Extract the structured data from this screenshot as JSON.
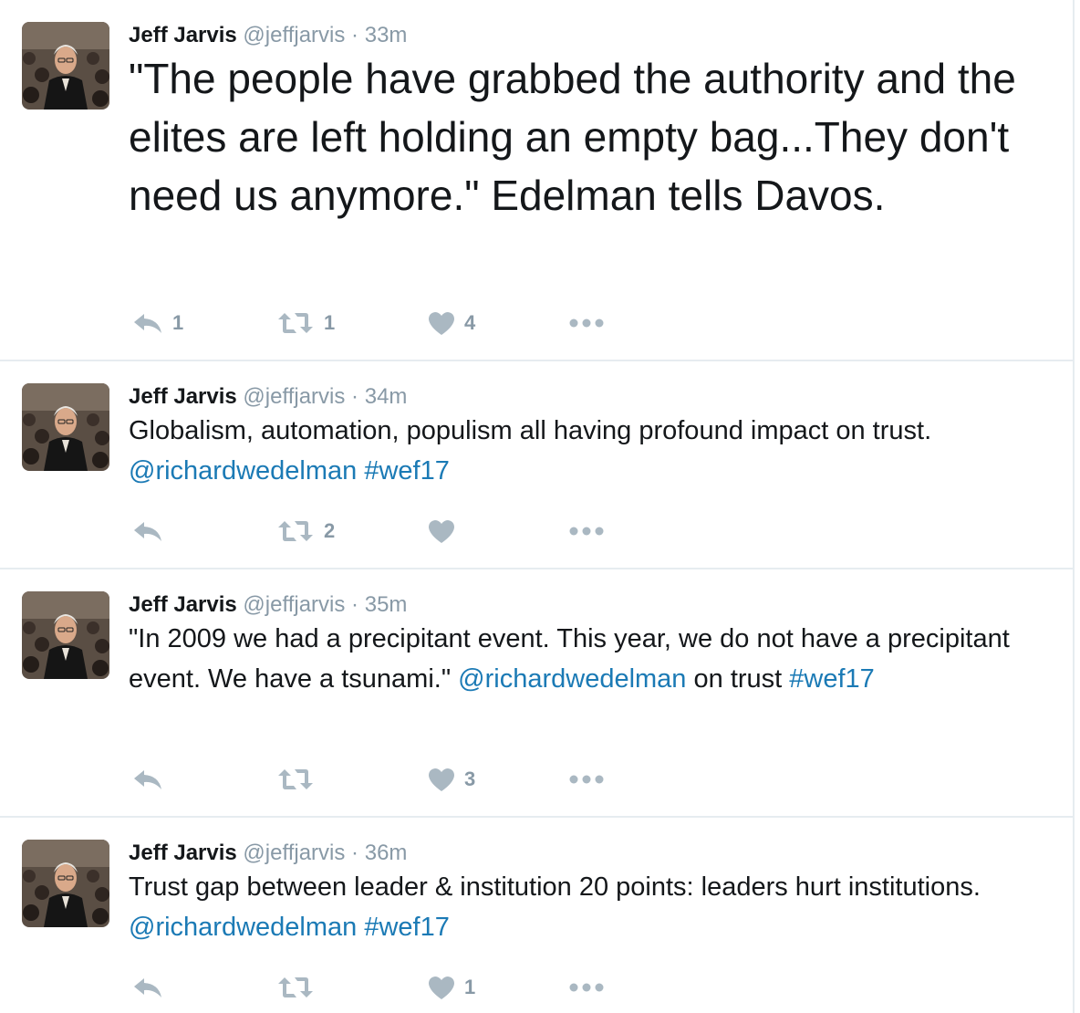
{
  "colors": {
    "link": "#1b7ab5",
    "meta": "#8899a6",
    "text": "#14171a",
    "divider": "#e6ecf0"
  },
  "icons": [
    "reply-icon",
    "retweet-icon",
    "like-heart-icon",
    "more-dots-icon"
  ],
  "tweets": [
    {
      "fullname": "Jeff Jarvis",
      "handle": "@jeffjarvis",
      "sep": "·",
      "time": "33m",
      "text_before": "\"The people have grabbed the authority and the elites are left holding an empty bag...They don't need us anymore.\" Edelman tells Davos.",
      "reply_count": "1",
      "retweet_count": "1",
      "like_count": "4"
    },
    {
      "fullname": "Jeff Jarvis",
      "handle": "@jeffjarvis",
      "sep": "·",
      "time": "34m",
      "text_before": "Globalism, automation, populism all having profound impact on trust. ",
      "mention": "@richardwedelman",
      "hashtag": "#wef17",
      "reply_count": "",
      "retweet_count": "2",
      "like_count": ""
    },
    {
      "fullname": "Jeff Jarvis",
      "handle": "@jeffjarvis",
      "sep": "·",
      "time": "35m",
      "text_before": "\"In 2009 we had a precipitant event. This year, we do not have a precipitant event. We have a tsunami.\" ",
      "mention": "@richardwedelman",
      "text_after": " on trust ",
      "hashtag": "#wef17",
      "reply_count": "",
      "retweet_count": "",
      "like_count": "3"
    },
    {
      "fullname": "Jeff Jarvis",
      "handle": "@jeffjarvis",
      "sep": "·",
      "time": "36m",
      "text_before": "Trust gap between leader & institution 20 points: leaders hurt institutions. ",
      "mention": "@richardwedelman",
      "hashtag": "#wef17",
      "reply_count": "",
      "retweet_count": "",
      "like_count": "1"
    }
  ]
}
